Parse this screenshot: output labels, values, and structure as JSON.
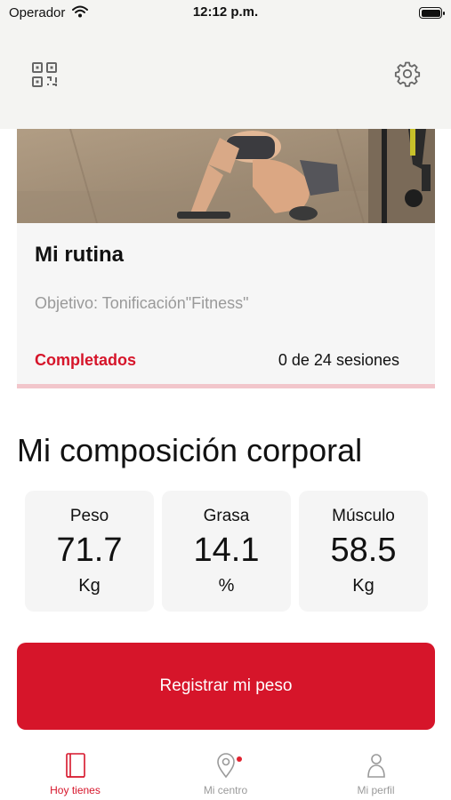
{
  "status_bar": {
    "carrier": "Operador",
    "time": "12:12 p.m."
  },
  "header": {
    "left_icon": "qr-code-icon",
    "right_icon": "gear-icon"
  },
  "routine": {
    "title": "Mi rutina",
    "goal": "Objetivo: Tonificación\"Fitness\"",
    "completed_label": "Completados",
    "sessions": "0 de 24 sesiones",
    "sessions_done": 0,
    "sessions_total": 24,
    "accent_color": "#d6152a"
  },
  "composition": {
    "title": "Mi composición corporal",
    "metrics": [
      {
        "label": "Peso",
        "value": "71.7",
        "unit": "Kg"
      },
      {
        "label": "Grasa",
        "value": "14.1",
        "unit": "%"
      },
      {
        "label": "Músculo",
        "value": "58.5",
        "unit": "Kg"
      }
    ]
  },
  "register_button": {
    "label": "Registrar mi peso"
  },
  "tabs": [
    {
      "label": "Hoy tienes",
      "icon": "book-icon",
      "active": true
    },
    {
      "label": "Mi centro",
      "icon": "location-pin-icon",
      "active": false,
      "badge": true
    },
    {
      "label": "Mi perfil",
      "icon": "person-icon",
      "active": false
    }
  ]
}
